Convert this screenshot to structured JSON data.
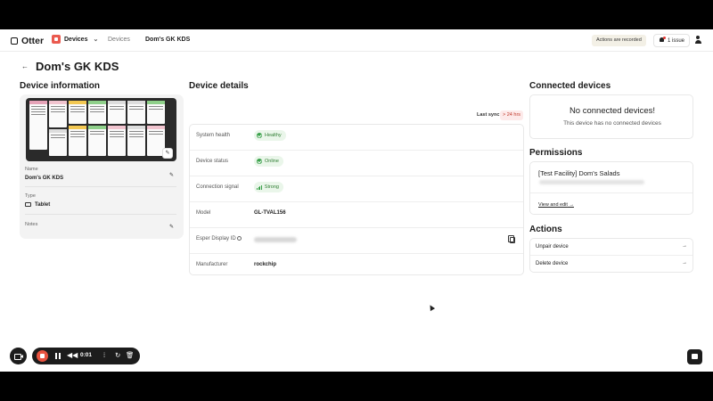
{
  "nav": {
    "logo": "Otter",
    "app": "Devices",
    "breadcrumb": [
      "Devices",
      "Dom's GK KDS"
    ],
    "recorded_badge": "Actions are recorded",
    "issues": "1 issue"
  },
  "page": {
    "title": "Dom's GK KDS"
  },
  "device_info": {
    "title": "Device information",
    "fields": [
      {
        "label": "Name",
        "value": "Dom's GK KDS"
      },
      {
        "label": "Type",
        "value": "Tablet"
      },
      {
        "label": "Notes",
        "value": ""
      }
    ]
  },
  "device_details": {
    "title": "Device details",
    "last_sync_label": "Last sync",
    "last_sync_value": "> 24 hrs",
    "rows": [
      {
        "label": "System health",
        "value": "Healthy",
        "kind": "pill-check"
      },
      {
        "label": "Device status",
        "value": "Online",
        "kind": "pill-check"
      },
      {
        "label": "Connection signal",
        "value": "Strong",
        "kind": "pill-signal"
      },
      {
        "label": "Model",
        "value": "GL-TVAL156",
        "kind": "text"
      },
      {
        "label": "Esper Display ID",
        "value": "",
        "kind": "redacted"
      },
      {
        "label": "Manufacturer",
        "value": "rockchip",
        "kind": "text"
      }
    ]
  },
  "connected_devices": {
    "title": "Connected devices",
    "empty_title": "No connected devices!",
    "empty_sub": "This device has no connected devices"
  },
  "permissions": {
    "title": "Permissions",
    "name": "[Test Facility] Dom's Salads",
    "link": "View and edit"
  },
  "actions": {
    "title": "Actions",
    "items": [
      "Unpair device",
      "Delete device"
    ]
  },
  "recorder": {
    "timer": "0:01"
  },
  "colors": {
    "accent_red": "#e8523f",
    "healthy_green": "#3aa14a",
    "sync_red": "#c0392b"
  },
  "icons": [
    "back-arrow-icon",
    "pencil-icon",
    "tablet-icon",
    "copy-icon",
    "info-icon",
    "bell-icon",
    "user-icon",
    "chevron-down-icon",
    "arrow-right-icon",
    "camera-icon",
    "stop-icon",
    "pause-icon",
    "rewind-icon",
    "waveform-icon",
    "redo-icon",
    "trash-icon",
    "chat-icon"
  ]
}
